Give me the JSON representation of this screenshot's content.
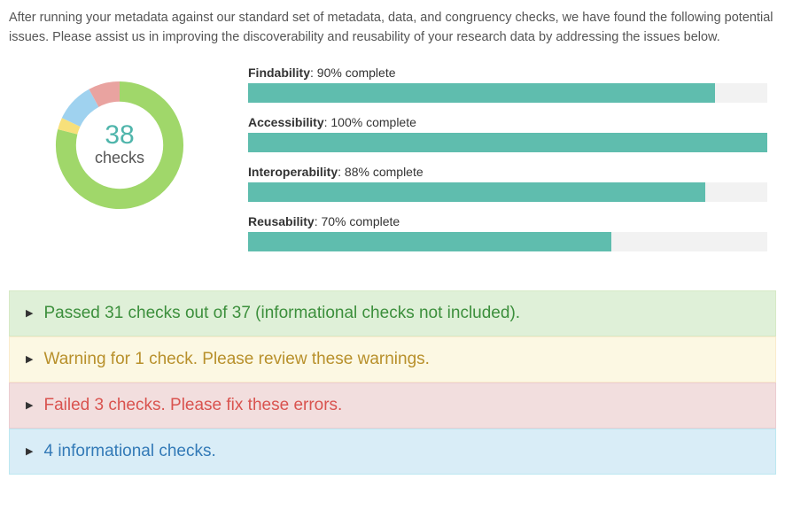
{
  "intro_text": "After running your metadata against our standard set of metadata, data, and congruency checks, we have found the following potential issues. Please assist us in improving the discoverability and reusability of your research data by addressing the issues below.",
  "donut": {
    "number": "38",
    "label": "checks"
  },
  "chart_data": {
    "type": "bar",
    "title": "",
    "xlabel": "",
    "ylabel": "% complete",
    "ylim": [
      0,
      100
    ],
    "categories": [
      "Findability",
      "Accessibility",
      "Interoperability",
      "Reusability"
    ],
    "values": [
      90,
      100,
      88,
      70
    ],
    "donut": {
      "type": "pie",
      "total": 38,
      "slices": [
        {
          "name": "passed",
          "value": 31,
          "color": "#a0d76a"
        },
        {
          "name": "warning",
          "value": 1,
          "color": "#f7e07a"
        },
        {
          "name": "info",
          "value": 4,
          "color": "#9fd2ef"
        },
        {
          "name": "failed",
          "value": 3,
          "color": "#e9a3a0"
        }
      ]
    }
  },
  "bars": [
    {
      "name": "Findability",
      "value_text": ": 90% complete",
      "pct": 90
    },
    {
      "name": "Accessibility",
      "value_text": ": 100% complete",
      "pct": 100
    },
    {
      "name": "Interoperability",
      "value_text": ": 88% complete",
      "pct": 88
    },
    {
      "name": "Reusability",
      "value_text": ": 70% complete",
      "pct": 70
    }
  ],
  "accordion": {
    "passed": "Passed 31 checks out of 37 (informational checks not included).",
    "warning": "Warning for 1 check. Please review these warnings.",
    "failed": "Failed 3 checks. Please fix these errors.",
    "info": "4 informational checks."
  }
}
